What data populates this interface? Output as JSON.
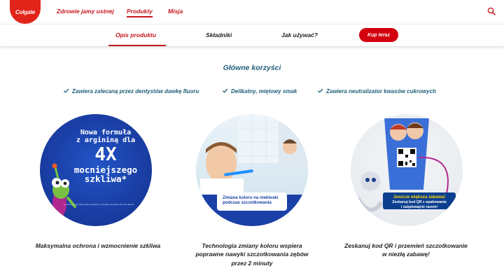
{
  "header": {
    "logo_text": "Colgate",
    "nav": [
      {
        "label": "Zdrowie jamy ustnej"
      },
      {
        "label": "Produkty"
      },
      {
        "label": "Misja"
      }
    ],
    "active_nav": "Produkty",
    "search_icon": "search-icon"
  },
  "subnav": {
    "tabs": [
      {
        "label": "Opis produktu"
      },
      {
        "label": "Składniki"
      },
      {
        "label": "Jak używać?"
      }
    ],
    "active_tab": "Opis produktu",
    "buy_label": "Kup teraz"
  },
  "benefits_section": {
    "title": "Główne korzyści",
    "items": [
      "Zawiera zalecaną przez dentystów dawkę fluoru",
      "Delikatny, miętowy smak",
      "Zawiera neutralizator kwasów cukrowych"
    ]
  },
  "features": [
    {
      "caption": "Maksymalna ochrona i wzmocnienie szkliwa",
      "promo": {
        "line1": "Nowa formuła",
        "line2": "z argininą dla",
        "big": "4X",
        "line3": "mocniejszego",
        "line4": "szkliwa*",
        "fine": "*w porównaniu do Colgate Kids bez argininy w przypadku stosowania dwa razy dziennie"
      }
    },
    {
      "caption_line1": "Technologia zmiany koloru wspiera",
      "caption_line2": "poprawne nawyki szczotkowania zębów",
      "caption_line3": "przez 2 minuty",
      "badge": "Zmiana koloru na niebieski podczas szczotkowania"
    },
    {
      "caption_line1": "Zeskanuj kod QR i przemień szczotkowanie",
      "caption_line2": "w niezłą zabawę!",
      "fun": {
        "line1": "Jeszcze większa zabawa!",
        "line2": "Zeskanuj kod QR z opakowania",
        "line3": "i zaśpiewajcie razem!"
      }
    }
  ],
  "colors": {
    "brand_red": "#c4161c",
    "button_red": "#d2010d",
    "teal_text": "#1e5f78",
    "promo_blue": "#1a3fa6"
  }
}
